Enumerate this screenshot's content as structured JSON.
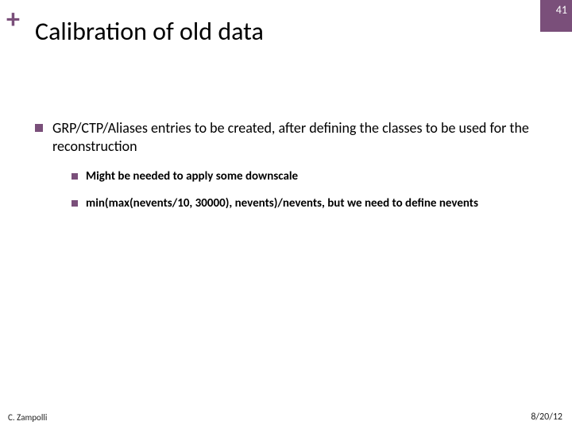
{
  "slide": {
    "plus_symbol": "+",
    "page_number": "41",
    "title": "Calibration of old data",
    "bullets": [
      {
        "text": "GRP/CTP/Aliases entries to be created, after defining the classes to be used for the reconstruction",
        "children": [
          {
            "text": "Might be needed to apply some downscale"
          },
          {
            "text": "min(max(nevents/10, 30000), nevents)/nevents, but we need to define nevents"
          }
        ]
      }
    ],
    "footer_author": "C. Zampolli",
    "footer_date": "8/20/12"
  }
}
